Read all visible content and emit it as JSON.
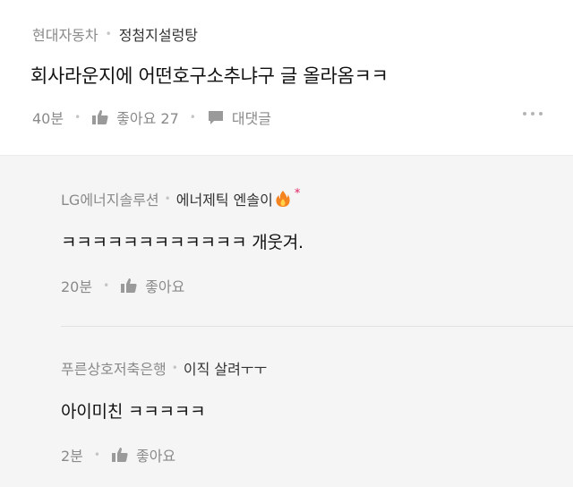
{
  "post": {
    "company": "현대자동차",
    "nickname": "정첨지설렁탕",
    "title": "회사라운지에 어떤호구소추냐구 글 올라옴ㅋㅋ",
    "time": "40분",
    "like_label": "좋아요 27",
    "comment_label": "대댓글"
  },
  "comments": [
    {
      "company": "LG에너지솔루션",
      "nickname": "에너제틱 엔솔이",
      "badge": "*",
      "text": "ㅋㅋㅋㅋㅋㅋㅋㅋㅋㅋㅋㅋ 개웃겨.",
      "time": "20분",
      "like_label": "좋아요"
    },
    {
      "company": "푸른상호저축은행",
      "nickname": "이직 살려ㅜㅜ",
      "text": "아이미친 ㅋㅋㅋㅋㅋ",
      "time": "2분",
      "like_label": "좋아요"
    }
  ],
  "colors": {
    "background": "#ffffff",
    "comment_background": "#f5f5f6",
    "muted_text": "#8a8a8a",
    "badge_red": "#e0245e",
    "fire_orange": "#f5831f"
  }
}
